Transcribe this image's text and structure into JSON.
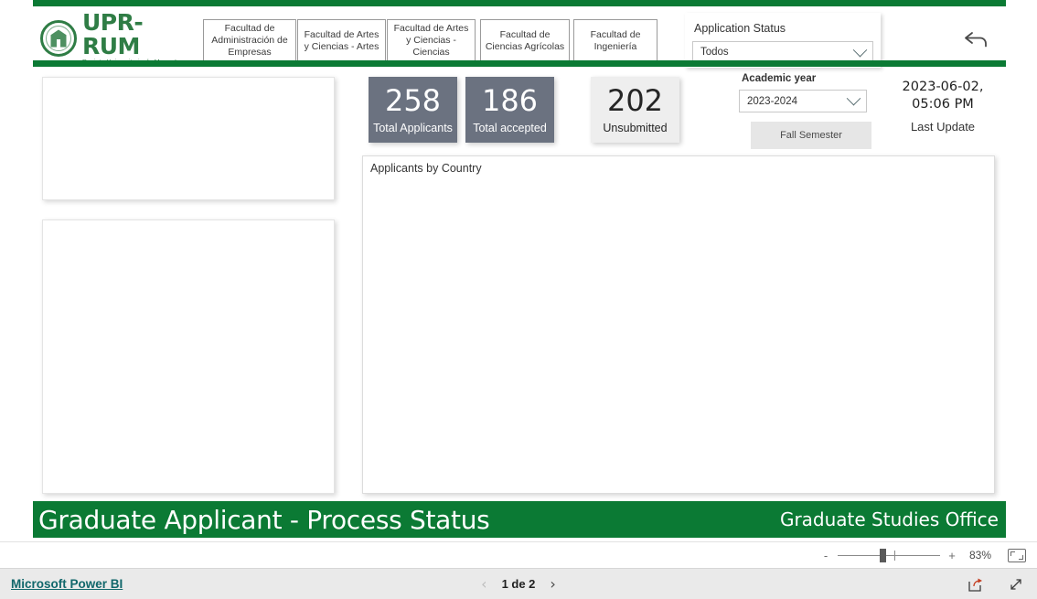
{
  "report": {
    "title": "Graduate Applicant - Process Status",
    "office": "Graduate Studies Office",
    "brand_green": "#0b7a34"
  },
  "logo": {
    "name": "UPR-RUM",
    "subtitle": "Recinto Universitario de Mayagüez",
    "seal_icon": "university-seal-icon"
  },
  "faculty_buttons": [
    {
      "label": "Facultad de Administración de Empresas"
    },
    {
      "label": "Facultad de Artes y Ciencias - Artes"
    },
    {
      "label": "Facultad de Artes y Ciencias - Ciencias"
    },
    {
      "label": "Facultad de Ciencias Agrícolas"
    },
    {
      "label": "Facultad de Ingeniería"
    }
  ],
  "status_slicer": {
    "label": "Application Status",
    "value": "Todos",
    "chevron_icon": "chevron-down-icon"
  },
  "back_button": {
    "icon": "back-arrow-icon"
  },
  "kpis": [
    {
      "value": "258",
      "label": "Total Applicants",
      "style": "dark"
    },
    {
      "value": "186",
      "label": "Total accepted",
      "style": "dark"
    },
    {
      "value": "202",
      "label": "Unsubmitted",
      "style": "light"
    }
  ],
  "year_slicer": {
    "label": "Academic year",
    "value": "2023-2024",
    "chevron_icon": "chevron-down-icon"
  },
  "semester_button": {
    "label": "Fall Semester"
  },
  "last_update": {
    "date": "2023-06-02,",
    "time": "05:06 PM",
    "caption": "Last Update"
  },
  "country_panel": {
    "title": "Applicants by Country"
  },
  "left_panels": [
    {
      "name": "empty-visual-top"
    },
    {
      "name": "empty-visual-bottom"
    }
  ],
  "zoom_bar": {
    "minus": "-",
    "plus": "+",
    "percent": "83%",
    "fit_icon": "fit-to-page-icon"
  },
  "footer": {
    "powerbi_link": "Microsoft Power BI",
    "page_label": "1 de 2",
    "prev_icon": "chevron-left-icon",
    "next_icon": "chevron-right-icon",
    "share_icon": "share-icon",
    "fullscreen_icon": "fullscreen-icon"
  }
}
